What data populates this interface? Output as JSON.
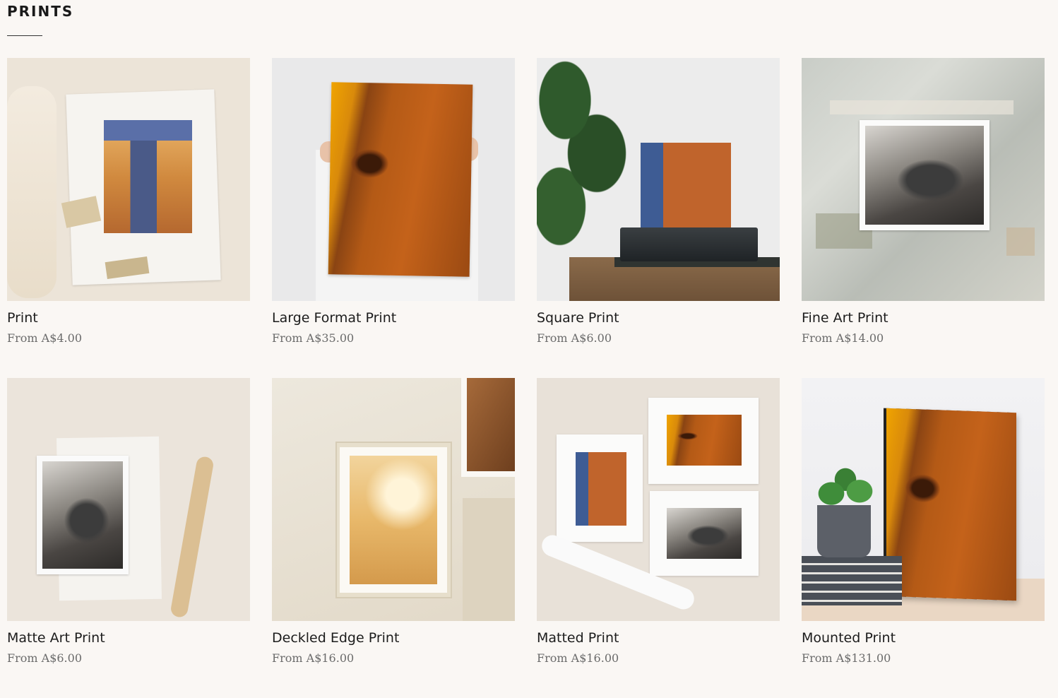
{
  "section": {
    "title": "PRINTS"
  },
  "products": [
    {
      "name": "Print",
      "price": "From A$4.00"
    },
    {
      "name": "Large Format Print",
      "price": "From A$35.00"
    },
    {
      "name": "Square Print",
      "price": "From A$6.00"
    },
    {
      "name": "Fine Art Print",
      "price": "From A$14.00"
    },
    {
      "name": "Matte Art Print",
      "price": "From A$6.00"
    },
    {
      "name": "Deckled Edge Print",
      "price": "From A$16.00"
    },
    {
      "name": "Matted Print",
      "price": "From A$16.00"
    },
    {
      "name": "Mounted Print",
      "price": "From A$131.00"
    }
  ]
}
